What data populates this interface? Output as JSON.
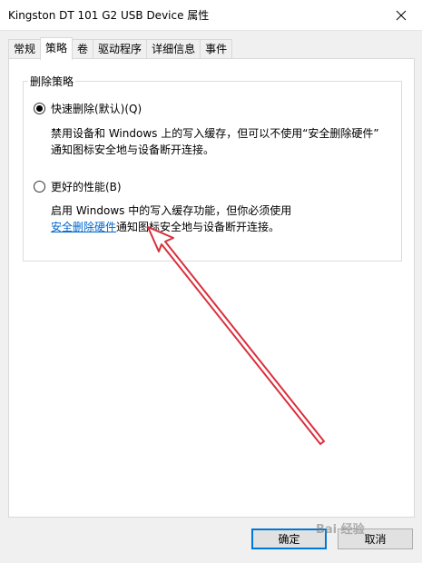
{
  "window": {
    "title": "Kingston DT 101 G2 USB Device 属性"
  },
  "tabs": [
    {
      "label": "常规",
      "active": false
    },
    {
      "label": "策略",
      "active": true
    },
    {
      "label": "卷",
      "active": false
    },
    {
      "label": "驱动程序",
      "active": false
    },
    {
      "label": "详细信息",
      "active": false
    },
    {
      "label": "事件",
      "active": false
    }
  ],
  "policy_group": {
    "label": "删除策略",
    "quick_removal": {
      "label": "快速删除(默认)(Q)",
      "selected": true,
      "desc_line1": "禁用设备和 Windows 上的写入缓存，但可以不使用“安全删除硬件”",
      "desc_line2": "通知图标安全地与设备断开连接。"
    },
    "better_performance": {
      "label": "更好的性能(B)",
      "selected": false,
      "desc_line1": "启用 Windows 中的写入缓存功能，但你必须使用",
      "desc_link": "安全删除硬件",
      "desc_line2_rest": "通知图标安全地与设备断开连接。"
    }
  },
  "buttons": {
    "ok": "确定",
    "cancel": "取消"
  },
  "watermark": "Bai 经验",
  "colors": {
    "link": "#0066cc",
    "arrow": "#d9303c",
    "default_button_border": "#0078d7"
  }
}
